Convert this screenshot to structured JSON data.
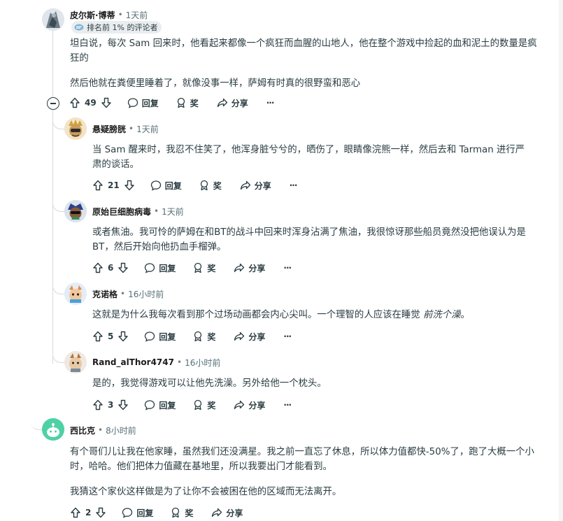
{
  "comments": [
    {
      "username": "皮尔斯·博蒂",
      "time": "1天前",
      "flair": "排名前 1% 的评论者",
      "paragraphs": [
        "坦白说，每次 Sam 回来时，他看起来都像一个疯狂而血腥的山地人，他在整个游戏中捡起的血和泥土的数量是疯狂的",
        "然后他就在粪便里睡着了，就像没事一样，萨姆有时真的很野蛮和恶心"
      ],
      "votes": "49",
      "reply_label": "回复",
      "award_label": "奖",
      "share_label": "分享",
      "more_label": "···"
    },
    {
      "username": "悬疑膀胱",
      "time": "1天前",
      "paragraphs": [
        "当 Sam 醒来时，我忍不住笑了，他浑身脏兮兮的，晒伤了，眼睛像浣熊一样，然后去和 Tarman 进行严肃的谈话。"
      ],
      "votes": "21",
      "reply_label": "回复",
      "award_label": "奖",
      "share_label": "分享",
      "more_label": "···"
    },
    {
      "username": "原始巨细胞病毒",
      "time": "1天前",
      "paragraphs": [
        "或者焦油。我可怜的萨姆在和BT的战斗中回来时浑身沾满了焦油，我很惊讶那些船员竟然没把他误认为是BT，然后开始向他扔血手榴弹。"
      ],
      "votes": "6",
      "reply_label": "回复",
      "award_label": "奖",
      "share_label": "分享",
      "more_label": "···"
    },
    {
      "username": "克诺格",
      "time": "16小时前",
      "paragraphs": [
        "这就是为什么我每次看到那个过场动画都会内心尖叫。一个理智的人应该在睡觉 "
      ],
      "italic": "前洗个澡",
      "italic_suffix": "。",
      "votes": "5",
      "reply_label": "回复",
      "award_label": "奖",
      "share_label": "分享",
      "more_label": "···"
    },
    {
      "username": "Rand_alThor4747",
      "time": "16小时前",
      "paragraphs": [
        "是的，我觉得游戏可以让他先洗澡。另外给他一个枕头。"
      ],
      "votes": "3",
      "reply_label": "回复",
      "award_label": "奖",
      "share_label": "分享",
      "more_label": "···"
    },
    {
      "username": "西比克",
      "time": "8小时前",
      "paragraphs": [
        "有个哥们儿让我在他家睡，虽然我们还没满星。我之前一直忘了休息，所以体力值都快-50%了，跑了大概一个小时，哈哈。他们把体力值藏在基地里，所以我要出门才能看到。",
        "我猜这个家伙这样做是为了让你不会被困在他的区域而无法离开。"
      ],
      "votes": "2",
      "reply_label": "回复",
      "award_label": "奖",
      "share_label": "分享"
    }
  ],
  "dot": "•",
  "colors": {
    "text": "#2a3c42",
    "meta": "#576f76",
    "thread_line": "#d7dadc",
    "flair_bg": "#eaedef"
  }
}
